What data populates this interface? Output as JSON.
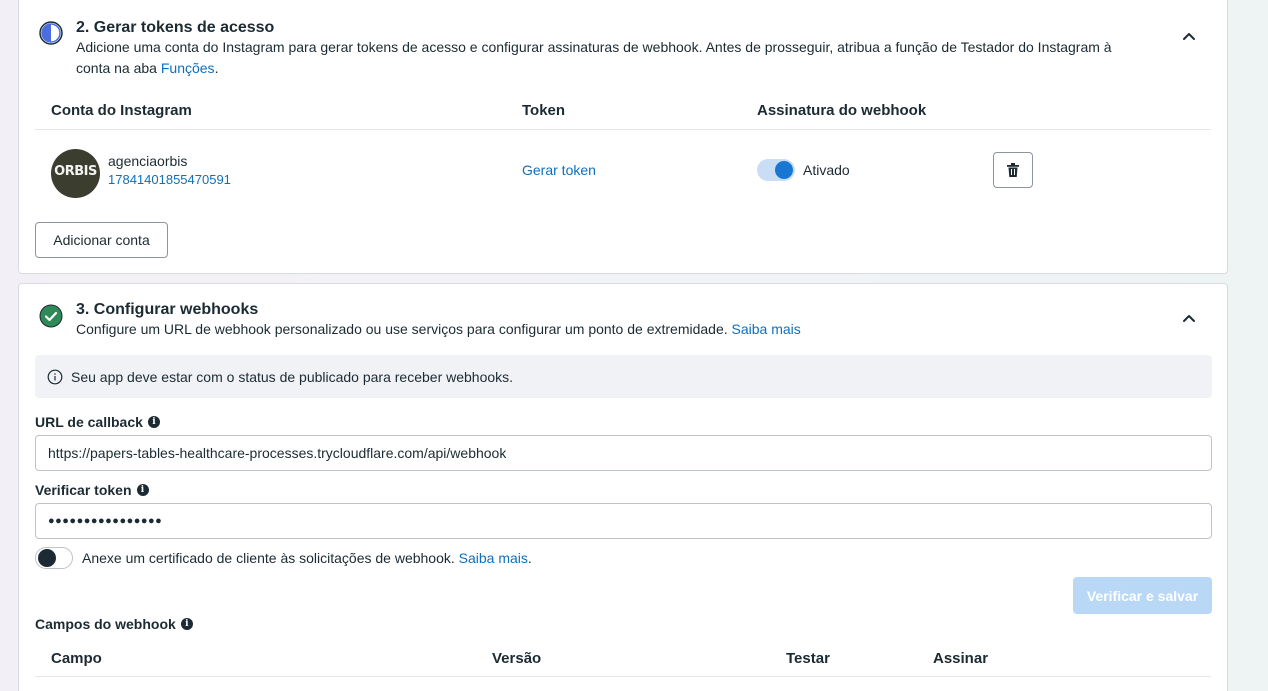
{
  "step2": {
    "title": "2. Gerar tokens de acesso",
    "description": "Adicione uma conta do Instagram para gerar tokens de acesso e configurar assinaturas de webhook. Antes de prosseguir, atribua a função de Testador do Instagram à",
    "description_line2": "conta na aba ",
    "roles_link": "Funções",
    "description_end": ".",
    "columns": {
      "account": "Conta do Instagram",
      "token": "Token",
      "subscription": "Assinatura do webhook"
    },
    "account": {
      "avatar_text": "ORBIS",
      "username": "agenciaorbis",
      "id": "17841401855470591",
      "token_link": "Gerar token",
      "subscription_status": "Ativado",
      "subscription_on": true
    },
    "add_account_label": "Adicionar conta"
  },
  "step3": {
    "title": "3. Configurar webhooks",
    "description": "Configure um URL de webhook personalizado ou use serviços para configurar um ponto de extremidade.",
    "learn_more": "Saiba mais",
    "info_message": "Seu app deve estar com o status de publicado para receber webhooks.",
    "callback_label": "URL de callback",
    "callback_value": "https://papers-tables-healthcare-processes.trycloudflare.com/api/webhook",
    "verify_token_label": "Verificar token",
    "verify_token_value": "●●●●●●●●●●●●●●●●",
    "cert_text": "Anexe um certificado de cliente às solicitações de webhook.",
    "cert_link": "Saiba mais",
    "cert_end": ".",
    "cert_on": false,
    "verify_save_label": "Verificar e salvar",
    "fields_label": "Campos do webhook",
    "table_columns": {
      "field": "Campo",
      "version": "Versão",
      "test": "Testar",
      "subscribe": "Assinar"
    }
  },
  "colors": {
    "accent": "#0f6fba",
    "toggle_on": "#1877d2",
    "success": "#2e8b57",
    "disabled_button": "#b8d8f6"
  }
}
